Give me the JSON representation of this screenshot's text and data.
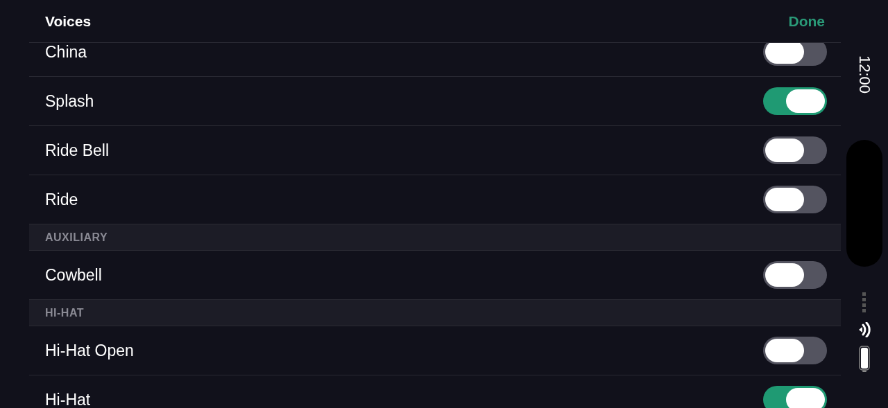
{
  "header": {
    "title": "Voices",
    "done": "Done"
  },
  "rows": [
    {
      "kind": "toggle",
      "label": "China",
      "on": false
    },
    {
      "kind": "toggle",
      "label": "Splash",
      "on": true
    },
    {
      "kind": "toggle",
      "label": "Ride Bell",
      "on": false
    },
    {
      "kind": "toggle",
      "label": "Ride",
      "on": false
    },
    {
      "kind": "section",
      "label": "AUXILIARY"
    },
    {
      "kind": "toggle",
      "label": "Cowbell",
      "on": false
    },
    {
      "kind": "section",
      "label": "HI-HAT"
    },
    {
      "kind": "toggle",
      "label": "Hi-Hat Open",
      "on": false
    },
    {
      "kind": "toggle",
      "label": "Hi-Hat",
      "on": true
    }
  ],
  "status_bar": {
    "time": "12:00"
  }
}
